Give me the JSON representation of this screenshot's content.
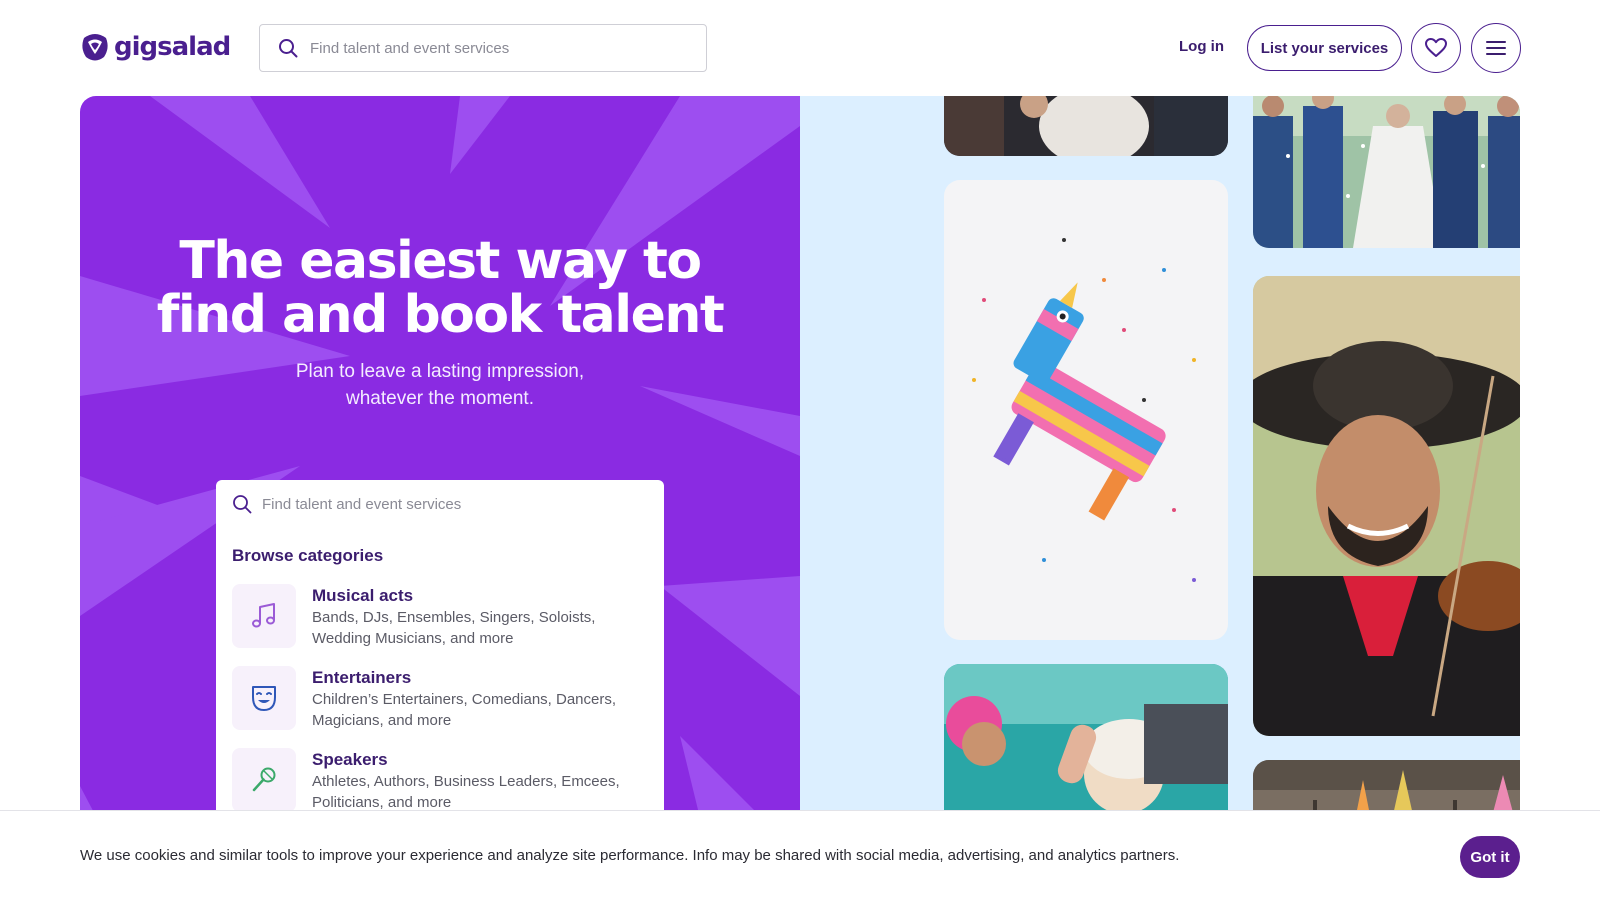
{
  "header": {
    "logo_text": "gigsalad",
    "search": {
      "placeholder": "Find talent and event services"
    },
    "login_label": "Log in",
    "list_services_label": "List your services",
    "favorites_icon": "heart-icon",
    "menu_icon": "hamburger-menu-icon"
  },
  "hero": {
    "title_line1": "The easiest way to",
    "title_line2": "find and book talent",
    "subtitle_line1": "Plan to leave a lasting impression,",
    "subtitle_line2": "whatever the moment.",
    "colors": {
      "left_bg": "#8a2be2",
      "right_bg": "#dcefff"
    }
  },
  "browse": {
    "search_placeholder": "Find talent and event services",
    "heading": "Browse categories",
    "categories": [
      {
        "title": "Musical acts",
        "desc_line1": "Bands, DJs, Ensembles, Singers, Soloists,",
        "desc_line2": "Wedding Musicians, and more",
        "icon": "music-note-icon"
      },
      {
        "title": "Entertainers",
        "desc_line1": "Children’s Entertainers, Comedians, Dancers,",
        "desc_line2": "Magicians, and more",
        "icon": "theater-mask-icon"
      },
      {
        "title": "Speakers",
        "desc_line1": "Athletes, Authors, Business Leaders, Emcees,",
        "desc_line2": "Politicians, and more",
        "icon": "microphone-icon"
      }
    ]
  },
  "photos": [
    {
      "subject": "wedding guests (top, cropped)"
    },
    {
      "subject": "bride and groomsmen with confetti"
    },
    {
      "subject": "colorful pinata with confetti"
    },
    {
      "subject": "mariachi violinist"
    },
    {
      "subject": "woman dancing at party"
    },
    {
      "subject": "party venue decorations"
    }
  ],
  "cookie": {
    "text": "We use cookies and similar tools to improve your experience and analyze site performance. Info may be shared with social media, advertising, and analytics partners.",
    "button_label": "Got it"
  }
}
